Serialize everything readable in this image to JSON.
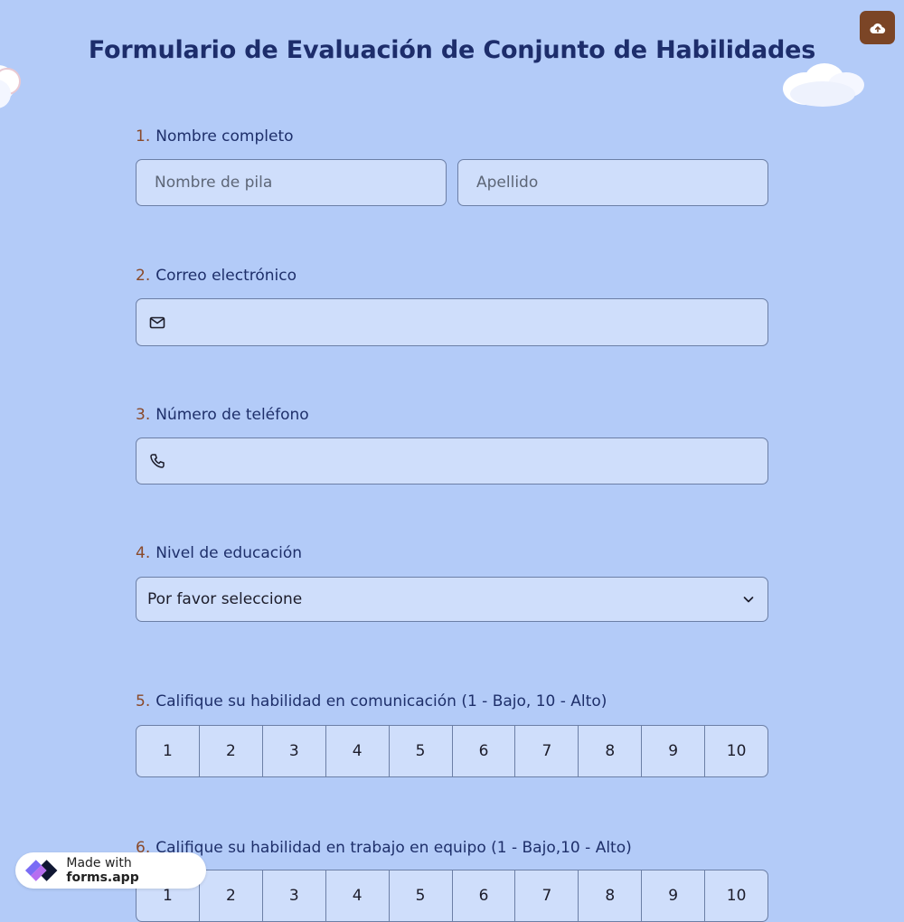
{
  "form": {
    "title": "Formulario de Evaluación de Conjunto de Habilidades"
  },
  "toolbar": {
    "upload_icon": "cloud-upload-icon",
    "accent_color": "#7b4526"
  },
  "questions": {
    "q1": {
      "number": "1.",
      "label": "Nombre completo",
      "first_placeholder": "Nombre de pila",
      "last_placeholder": "Apellido",
      "first_value": "",
      "last_value": ""
    },
    "q2": {
      "number": "2.",
      "label": "Correo electrónico",
      "icon": "envelope-icon",
      "value": ""
    },
    "q3": {
      "number": "3.",
      "label": "Número de teléfono",
      "icon": "phone-icon",
      "value": ""
    },
    "q4": {
      "number": "4.",
      "label": "Nivel de educación",
      "selected": "Por favor seleccione",
      "icon": "chevron-down-icon"
    },
    "q5": {
      "number": "5.",
      "label": "Califique su habilidad en comunicación (1 - Bajo, 10 - Alto)",
      "options": [
        "1",
        "2",
        "3",
        "4",
        "5",
        "6",
        "7",
        "8",
        "9",
        "10"
      ]
    },
    "q6": {
      "number": "6.",
      "label": "Califique su habilidad en trabajo en equipo (1 - Bajo,10 - Alto)",
      "options": [
        "1",
        "2",
        "3",
        "4",
        "5",
        "6",
        "7",
        "8",
        "9",
        "10"
      ]
    }
  },
  "badge": {
    "prefix": "Made with",
    "brand": "forms.app",
    "icon": "forms-app-logo-icon"
  },
  "colors": {
    "background": "#b3cbf8",
    "field_background": "#cfdefb",
    "title": "#1d2d6b",
    "question_number": "#8a4a2a"
  }
}
